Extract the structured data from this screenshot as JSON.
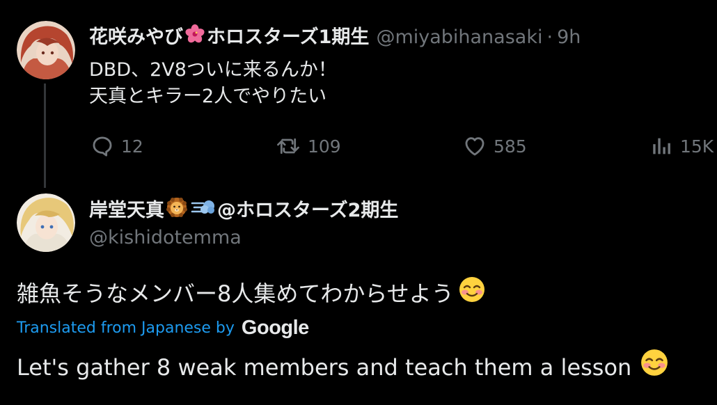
{
  "tweet1": {
    "display_name": "花咲みやび",
    "display_name_suffix": "ホロスターズ1期生",
    "flower_emoji": "hibiscus-emoji",
    "handle": "@miyabihanasaki",
    "separator": "·",
    "time": "9h",
    "text_lines": [
      "DBD、2V8ついに来るんか！",
      "天真とキラー2人でやりたい"
    ],
    "actions": {
      "replies": "12",
      "retweets": "109",
      "likes": "585",
      "views": "15K"
    }
  },
  "tweet2": {
    "display_name": "岸堂天真",
    "lion_emoji": "lion-emoji",
    "dash_emoji": "dash-emoji",
    "display_name_suffix": "@ホロスターズ2期生",
    "handle": "@kishidotemma",
    "text": "雑魚そうなメンバー8人集めてわからせよう",
    "smile_emoji": "smiling-face-emoji",
    "translated_label": "Translated from Japanese by",
    "translator": "Google",
    "translation": "Let's gather 8 weak members and teach them a lesson"
  },
  "colors": {
    "background": "#000000",
    "text_primary": "#e7e9ea",
    "text_muted": "#71767b",
    "link_blue": "#1d9bf0",
    "thread_line": "#333639"
  }
}
